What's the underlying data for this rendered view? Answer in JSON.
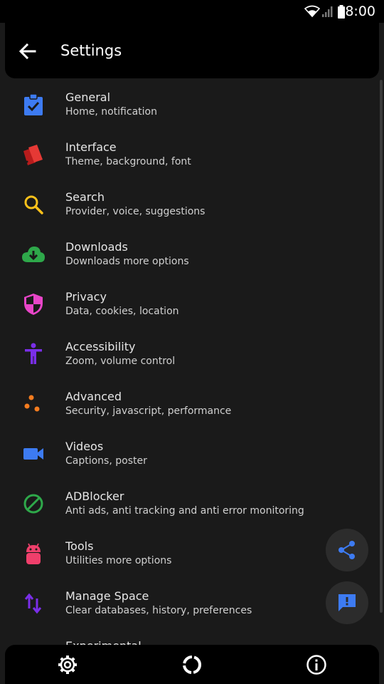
{
  "status_bar": {
    "time": "8:00",
    "icons": [
      "wifi-icon",
      "signal-icon",
      "battery-icon"
    ]
  },
  "app_bar": {
    "title": "Settings",
    "back_icon": "arrow-left-icon"
  },
  "items": [
    {
      "title": "General",
      "subtitle": "Home, notification",
      "icon": "clipboard-check-icon",
      "color": "#3d7bf2"
    },
    {
      "title": "Interface",
      "subtitle": "Theme, background, font",
      "icon": "palette-cards-icon",
      "color": "#e53935"
    },
    {
      "title": "Search",
      "subtitle": "Provider, voice, suggestions",
      "icon": "search-icon",
      "color": "#f9c11a"
    },
    {
      "title": "Downloads",
      "subtitle": "Downloads more options",
      "icon": "cloud-download-icon",
      "color": "#2ea84a"
    },
    {
      "title": "Privacy",
      "subtitle": "Data, cookies, location",
      "icon": "shield-icon",
      "color": "#e845c8"
    },
    {
      "title": "Accessibility",
      "subtitle": "Zoom, volume control",
      "icon": "accessibility-icon",
      "color": "#7a2ee8"
    },
    {
      "title": "Advanced",
      "subtitle": "Security, javascript, performance",
      "icon": "dots-icon",
      "color": "#f57c1f"
    },
    {
      "title": "Videos",
      "subtitle": "Captions, poster",
      "icon": "video-camera-icon",
      "color": "#3d7bf2"
    },
    {
      "title": "ADBlocker",
      "subtitle": "Anti ads, anti tracking and anti error monitoring",
      "icon": "block-icon",
      "color": "#2ea84a"
    },
    {
      "title": "Tools",
      "subtitle": "Utilities more options",
      "icon": "android-icon",
      "color": "#ef3f6b"
    },
    {
      "title": "Manage Space",
      "subtitle": "Clear databases, history, preferences",
      "icon": "swap-vertical-icon",
      "color": "#7a2ee8"
    },
    {
      "title": "Experimental",
      "subtitle": "",
      "icon": "flask-icon",
      "color": "#3d7bf2"
    }
  ],
  "fabs": {
    "share_icon": "share-icon",
    "feedback_icon": "feedback-icon",
    "icon_color": "#3d7bf2"
  },
  "bottom_nav": {
    "icons": [
      "gear-icon",
      "loading-ring-icon",
      "info-icon"
    ]
  }
}
